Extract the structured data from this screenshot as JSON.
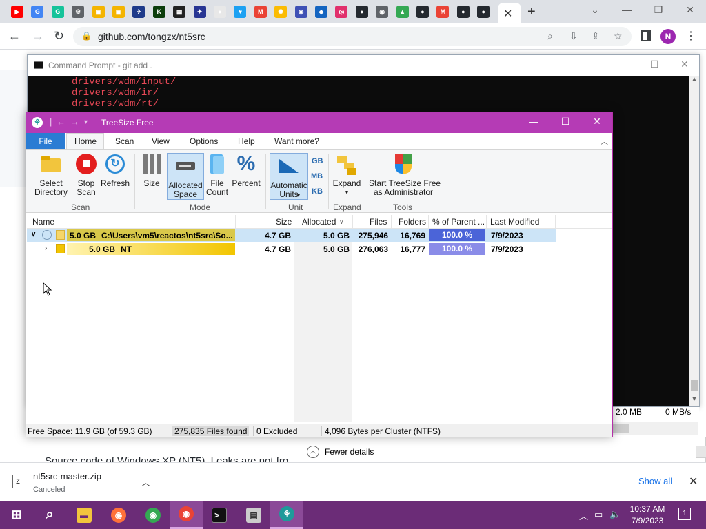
{
  "browser": {
    "url": "github.com/tongzx/nt5src",
    "tab_favicons": [
      {
        "icon": "youtube-icon",
        "color": "#ff0000",
        "glyph": "▶"
      },
      {
        "icon": "google-icon",
        "color": "#4285f4",
        "glyph": "G"
      },
      {
        "icon": "grammarly-icon",
        "color": "#15c39a",
        "glyph": "G"
      },
      {
        "icon": "settings-icon",
        "color": "#5f6368",
        "glyph": "⚙"
      },
      {
        "icon": "folder-icon",
        "color": "#f4b400",
        "glyph": "▣"
      },
      {
        "icon": "folder-icon",
        "color": "#f4b400",
        "glyph": "▣"
      },
      {
        "icon": "bird-icon",
        "color": "#1e3a8a",
        "glyph": "✈"
      },
      {
        "icon": "kim-icon",
        "color": "#0b3d0b",
        "glyph": "K"
      },
      {
        "icon": "qr-icon",
        "color": "#222222",
        "glyph": "▦"
      },
      {
        "icon": "app-icon",
        "color": "#283593",
        "glyph": "✦"
      },
      {
        "icon": "circle-icon",
        "color": "#e8e8e8",
        "glyph": "●"
      },
      {
        "icon": "twitter-icon",
        "color": "#1da1f2",
        "glyph": "♥"
      },
      {
        "icon": "gmail-icon",
        "color": "#ea4335",
        "glyph": "M"
      },
      {
        "icon": "bulb-icon",
        "color": "#fbbc04",
        "glyph": "✺"
      },
      {
        "icon": "avatar-icon",
        "color": "#3f51b5",
        "glyph": "◉"
      },
      {
        "icon": "sonic-icon",
        "color": "#1565c0",
        "glyph": "◆"
      },
      {
        "icon": "instagram-icon",
        "color": "#e1306c",
        "glyph": "◎"
      },
      {
        "icon": "github-icon",
        "color": "#24292f",
        "glyph": "●"
      },
      {
        "icon": "chrome-icon",
        "color": "#5f6368",
        "glyph": "◉"
      },
      {
        "icon": "drive-icon",
        "color": "#34a853",
        "glyph": "▲"
      },
      {
        "icon": "github-icon",
        "color": "#24292f",
        "glyph": "●"
      },
      {
        "icon": "gmail-icon",
        "color": "#ea4335",
        "glyph": "M"
      },
      {
        "icon": "github-icon",
        "color": "#24292f",
        "glyph": "●"
      },
      {
        "icon": "github-icon",
        "color": "#24292f",
        "glyph": "●"
      }
    ],
    "profile_initial": "N",
    "page_text": "Source code of Windows XP (NT5). Leaks are not fro"
  },
  "cmd": {
    "title": "Command Prompt - git  add .",
    "lines": [
      "drivers/wdm/input/",
      "drivers/wdm/ir/",
      "drivers/wdm/rt/"
    ],
    "stat_mb": "2.0 MB",
    "stat_rate": "0 MB/s"
  },
  "taskmanager": {
    "fewer_details": "Fewer details"
  },
  "treesize": {
    "title": "TreeSize Free",
    "tabs": [
      "File",
      "Home",
      "Scan",
      "View",
      "Options",
      "Help",
      "Want more?"
    ],
    "ribbon": {
      "select_directory": "Select\nDirectory",
      "stop_scan": "Stop\nScan",
      "refresh": "Refresh",
      "size": "Size",
      "allocated_space": "Allocated\nSpace",
      "file_count": "File\nCount",
      "percent": "Percent",
      "automatic_units": "Automatic\nUnits",
      "unit_gb": "GB",
      "unit_mb": "MB",
      "unit_kb": "KB",
      "expand": "Expand",
      "start_admin": "Start TreeSize Free\nas Administrator",
      "groups": {
        "scan": "Scan",
        "mode": "Mode",
        "unit": "Unit",
        "expand": "Expand",
        "tools": "Tools"
      }
    },
    "columns": [
      "Name",
      "Size",
      "Allocated",
      "Files",
      "Folders",
      "% of Parent ...",
      "Last Modified"
    ],
    "rows": [
      {
        "size_label": "5.0 GB",
        "name": "C:\\Users\\vm5\\reactos\\nt5src\\So...",
        "size": "4.7 GB",
        "allocated": "5.0 GB",
        "files": "275,946",
        "folders": "16,769",
        "pct": "100.0 %",
        "pct_value": 100,
        "modified": "7/9/2023",
        "bar_color": "#d9c84a",
        "pct_color": "#4b64d8"
      },
      {
        "size_label": "5.0 GB",
        "name": "NT",
        "size": "4.7 GB",
        "allocated": "5.0 GB",
        "files": "276,063",
        "folders": "16,777",
        "pct": "100.0 %",
        "pct_value": 100,
        "modified": "7/9/2023",
        "bar_color": "#f2c500",
        "pct_color": "#8a8ce8"
      }
    ],
    "status": {
      "free_space": "Free Space: 11.9 GB  (of 59.3 GB)",
      "files_found": "275,835 Files found",
      "excluded": "0 Excluded",
      "cluster": "4,096 Bytes per Cluster (NTFS)"
    }
  },
  "downloads": {
    "file_name": "nt5src-master.zip",
    "status": "Canceled",
    "show_all": "Show all"
  },
  "taskbar": {
    "time": "10:37 AM",
    "date": "7/9/2023",
    "notifications": "1"
  }
}
